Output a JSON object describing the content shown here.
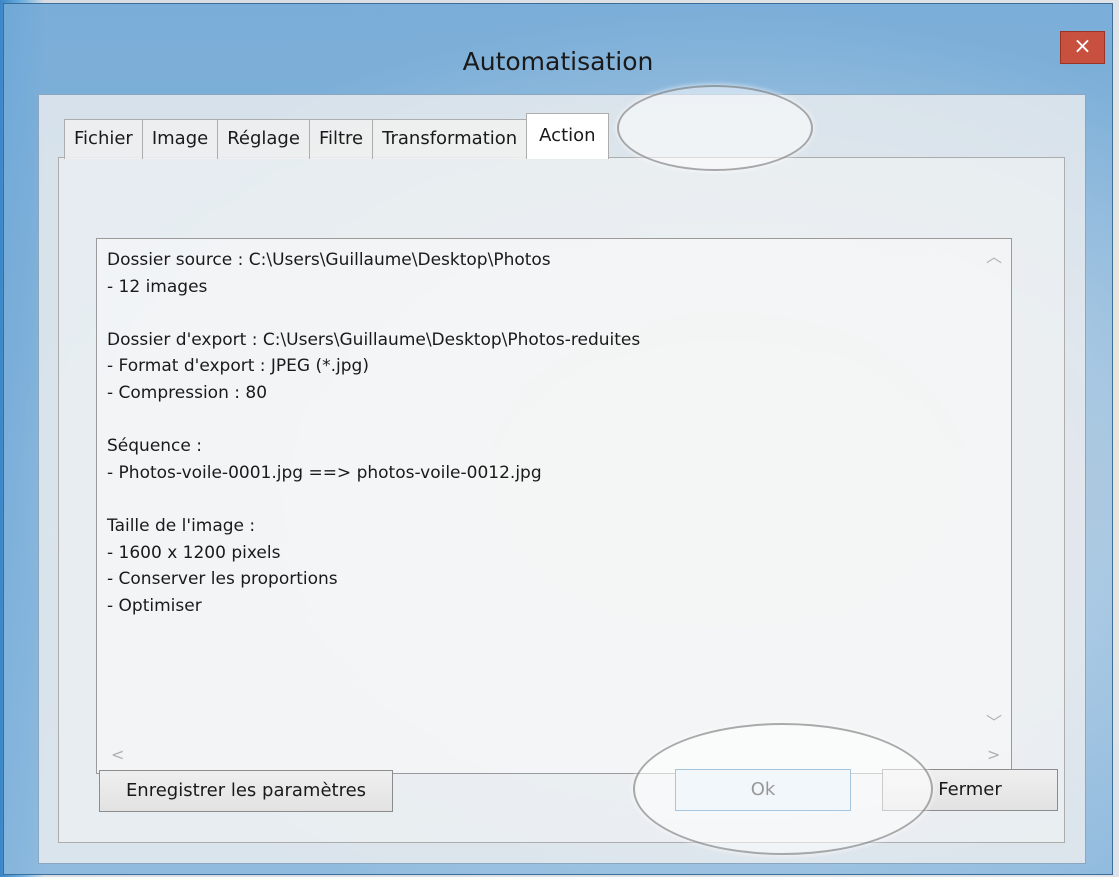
{
  "window": {
    "title": "Automatisation",
    "close_glyph": "×"
  },
  "tabs": [
    {
      "label": "Fichier"
    },
    {
      "label": "Image"
    },
    {
      "label": "Réglage"
    },
    {
      "label": "Filtre"
    },
    {
      "label": "Transformation"
    },
    {
      "label": "Action"
    }
  ],
  "active_tab": "Action",
  "summary": {
    "lines": [
      "Dossier source : C:\\Users\\Guillaume\\Desktop\\Photos",
      "- 12 images",
      "",
      "Dossier d'export : C:\\Users\\Guillaume\\Desktop\\Photos-reduites",
      "- Format d'export : JPEG (*.jpg)",
      "- Compression : 80",
      "",
      "Séquence :",
      "- Photos-voile-0001.jpg ==> photos-voile-0012.jpg",
      "",
      "Taille de l'image :",
      "- 1600 x 1200 pixels",
      "- Conserver les proportions",
      "- Optimiser"
    ]
  },
  "scroll": {
    "up": "︿",
    "down": "﹀",
    "left": "<",
    "right": ">"
  },
  "buttons": {
    "save": "Enregistrer les paramètres",
    "ok": "Ok",
    "close": "Fermer"
  },
  "colors": {
    "close_button": "#c7503f",
    "ok_focus_border": "#3c7fb1"
  }
}
